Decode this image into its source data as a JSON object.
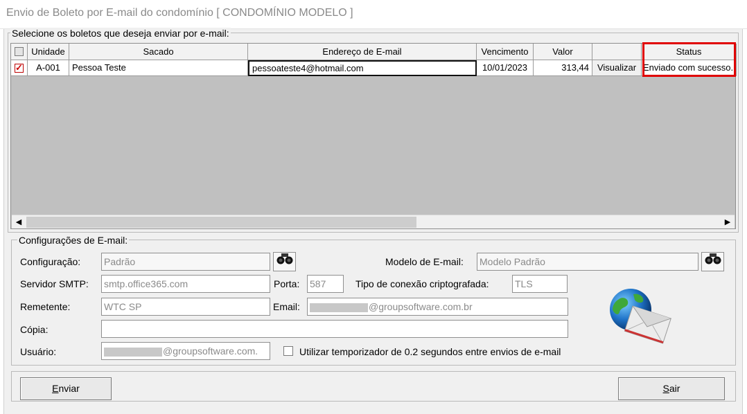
{
  "window": {
    "title": "Envio de Boleto por E-mail do condomínio [ CONDOMÍNIO MODELO ]"
  },
  "selection_group": {
    "legend": "Selecione os boletos que deseja enviar por e-mail:"
  },
  "table": {
    "columns": {
      "unidade": "Unidade",
      "sacado": "Sacado",
      "email": "Endereço de E-mail",
      "vencimento": "Vencimento",
      "valor": "Valor",
      "acao": "",
      "status": "Status"
    },
    "rows": [
      {
        "checked": true,
        "unidade": "A-001",
        "sacado": "Pessoa Teste",
        "email": "pessoateste4@hotmail.com",
        "vencimento": "10/01/2023",
        "valor": "313,44",
        "acao": "Visualizar",
        "status": "Enviado com sucesso."
      }
    ],
    "highlight_color": "#e00000"
  },
  "config_group": {
    "legend": "Configurações de E-mail:",
    "configuracao_label": "Configuração:",
    "configuracao_value": "Padrão",
    "modelo_label": "Modelo de E-mail:",
    "modelo_value": "Modelo Padrão",
    "smtp_label": "Servidor SMTP:",
    "smtp_value": "smtp.office365.com",
    "porta_label": "Porta:",
    "porta_value": "587",
    "tipo_label": "Tipo de conexão criptografada:",
    "tipo_value": "TLS",
    "remetente_label": "Remetente:",
    "remetente_value": "WTC SP",
    "email_label": "Email:",
    "email_value": "@groupsoftware.com.br",
    "copia_label": "Cópia:",
    "copia_value": "",
    "usuario_label": "Usuário:",
    "usuario_value": "@groupsoftware.com.",
    "temporizador_label": "Utilizar temporizador de 0.2 segundos entre envios de e-mail",
    "temporizador_checked": false,
    "icons": [
      "binoculars-icon",
      "globe-mail-icon"
    ]
  },
  "footer": {
    "enviar_label": "nviar",
    "enviar_mnemonic": "E",
    "sair_label": "air",
    "sair_mnemonic": "S"
  }
}
